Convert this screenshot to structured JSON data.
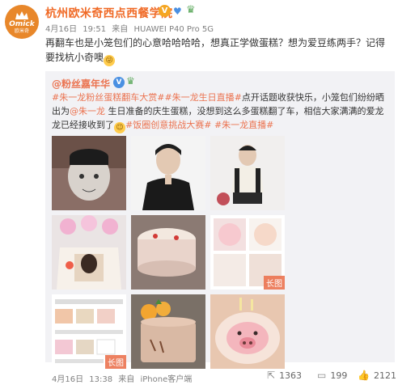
{
  "author": {
    "name": "杭州欧米奇西点西餐学院",
    "avatar_text": "Omick",
    "avatar_cn": "欧米奇",
    "verified_badge": "V"
  },
  "post": {
    "date": "4月16日",
    "time": "19:51",
    "source_prefix": "来自",
    "source": "HUAWEI P40 Pro 5G",
    "text": "再翻车也是小笼包们的心意哈哈哈哈，想真正学做蛋糕？想为爱豆练两手？记得要找杭小奇噢",
    "emoji": "😜"
  },
  "repost": {
    "author": "@粉丝嘉年华",
    "verified_badge": "V",
    "segments": [
      {
        "t": "#朱一龙粉丝蛋糕翻车大赏#",
        "type": "topic"
      },
      {
        "t": "#朱一龙生日直播#",
        "type": "topic"
      },
      {
        "t": "点开话题收获快乐，小笼包们纷纷晒出为",
        "type": "text"
      },
      {
        "t": "@朱一龙",
        "type": "mention"
      },
      {
        "t": " 生日准备的庆生蛋糕，没想到这么多蛋糕翻了车，相信大家满满的爱龙龙已经接收到了",
        "type": "text"
      },
      {
        "t": "😉",
        "type": "emoji"
      },
      {
        "t": "#饭圈创意挑战大赛#",
        "type": "topic"
      },
      {
        "t": " ",
        "type": "text"
      },
      {
        "t": "#朱一龙直播#",
        "type": "topic"
      }
    ],
    "long_image_label": "长图",
    "image_count": 9
  },
  "footer": {
    "date": "4月16日",
    "time": "13:38",
    "source_prefix": "来自",
    "source": "iPhone客户端",
    "reposts": "1363",
    "comments": "199",
    "likes": "2121"
  },
  "colors": {
    "brand_orange": "#f06a26",
    "link": "#eb7350",
    "repost_bg": "#f2f2f5",
    "meta_gray": "#808080"
  }
}
